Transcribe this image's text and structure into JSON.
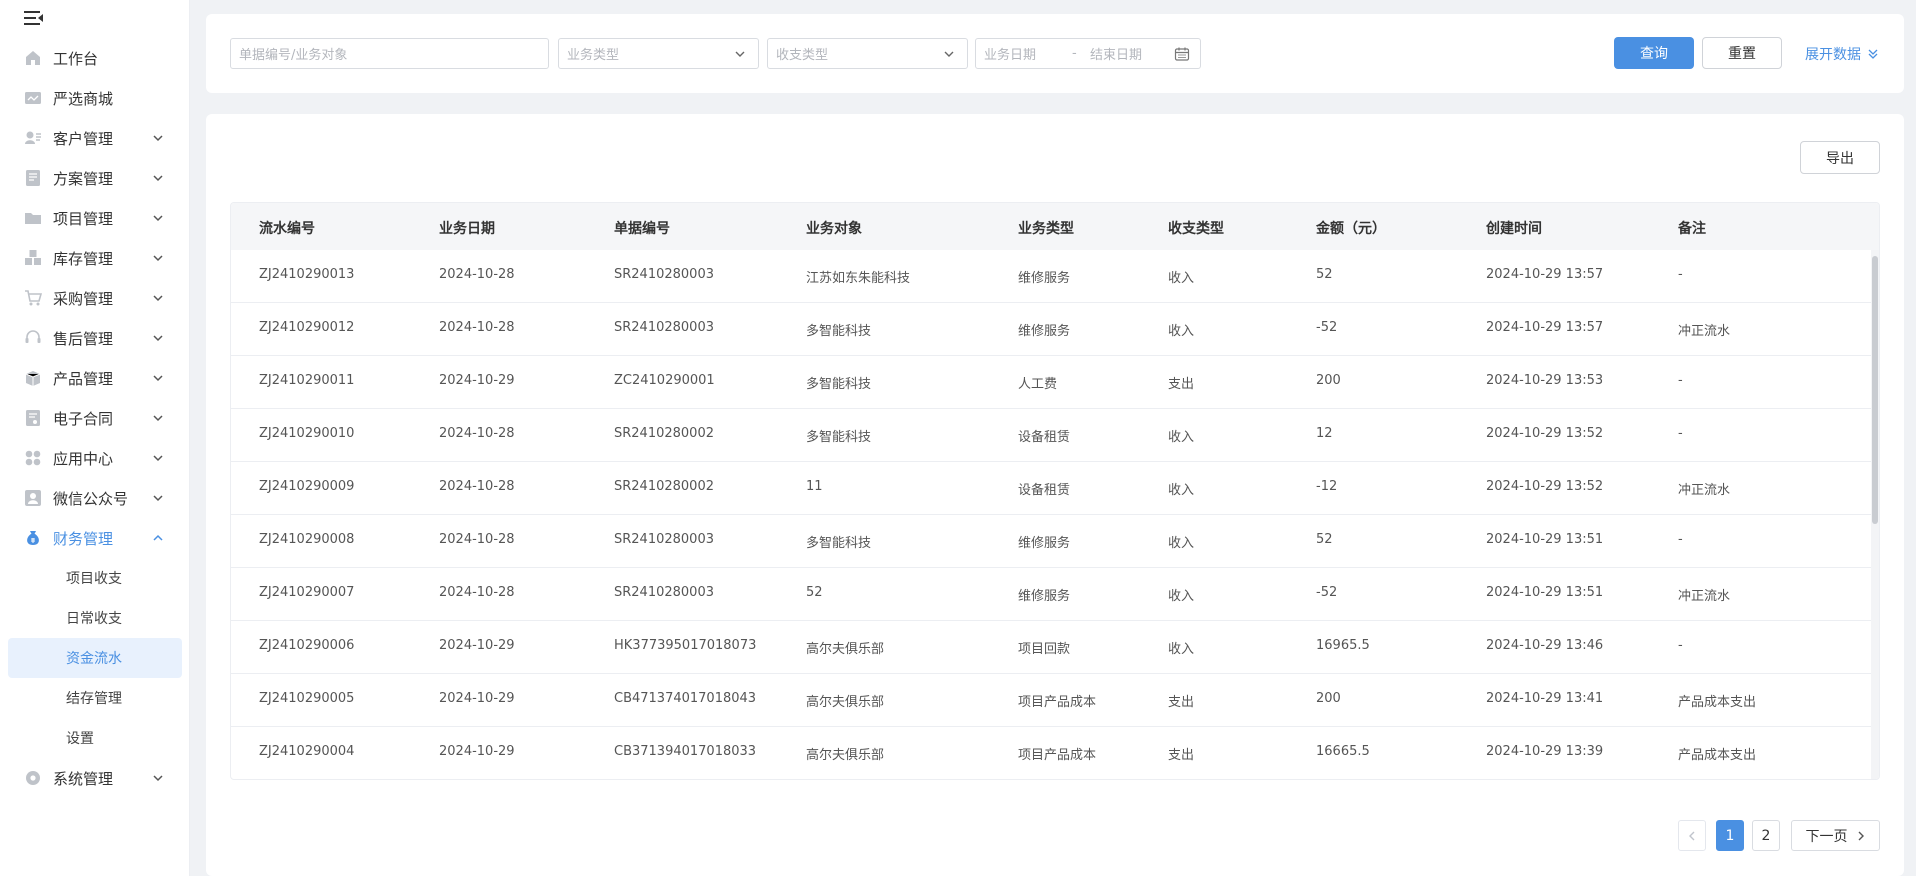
{
  "sidebar": {
    "items": [
      {
        "label": "工作台",
        "icon": "home-icon",
        "has_children": false
      },
      {
        "label": "严选商城",
        "icon": "store-icon",
        "has_children": false
      },
      {
        "label": "客户管理",
        "icon": "customer-icon",
        "has_children": true
      },
      {
        "label": "方案管理",
        "icon": "plan-icon",
        "has_children": true
      },
      {
        "label": "项目管理",
        "icon": "folder-icon",
        "has_children": true
      },
      {
        "label": "库存管理",
        "icon": "inventory-icon",
        "has_children": true
      },
      {
        "label": "采购管理",
        "icon": "cart-icon",
        "has_children": true
      },
      {
        "label": "售后管理",
        "icon": "headset-icon",
        "has_children": true
      },
      {
        "label": "产品管理",
        "icon": "box-icon",
        "has_children": true
      },
      {
        "label": "电子合同",
        "icon": "contract-icon",
        "has_children": true
      },
      {
        "label": "应用中心",
        "icon": "apps-icon",
        "has_children": true
      },
      {
        "label": "微信公众号",
        "icon": "wechat-icon",
        "has_children": true
      },
      {
        "label": "财务管理",
        "icon": "moneybag-icon",
        "has_children": true,
        "expanded": true,
        "active": true
      }
    ],
    "finance_sub": [
      {
        "label": "项目收支"
      },
      {
        "label": "日常收支"
      },
      {
        "label": "资金流水",
        "selected": true
      },
      {
        "label": "结存管理"
      },
      {
        "label": "设置"
      }
    ],
    "last_item": {
      "label": "系统管理",
      "icon": "system-icon",
      "has_children": true
    }
  },
  "filters": {
    "search_placeholder": "单据编号/业务对象",
    "biz_type_placeholder": "业务类型",
    "io_type_placeholder": "收支类型",
    "date_start_placeholder": "业务日期",
    "date_separator": "-",
    "date_end_placeholder": "结束日期",
    "query_label": "查询",
    "reset_label": "重置",
    "expand_label": "展开数据"
  },
  "toolbar": {
    "export_label": "导出"
  },
  "table": {
    "headers": [
      "流水编号",
      "业务日期",
      "单据编号",
      "业务对象",
      "业务类型",
      "收支类型",
      "金额（元）",
      "创建时间",
      "备注"
    ],
    "rows": [
      [
        "ZJ2410290013",
        "2024-10-28",
        "SR2410280003",
        "江苏如东朱能科技",
        "维修服务",
        "收入",
        "52",
        "2024-10-29 13:57",
        "-"
      ],
      [
        "ZJ2410290012",
        "2024-10-28",
        "SR2410280003",
        "多智能科技",
        "维修服务",
        "收入",
        "-52",
        "2024-10-29 13:57",
        "冲正流水"
      ],
      [
        "ZJ2410290011",
        "2024-10-29",
        "ZC2410290001",
        "多智能科技",
        "人工费",
        "支出",
        "200",
        "2024-10-29 13:53",
        "-"
      ],
      [
        "ZJ2410290010",
        "2024-10-28",
        "SR2410280002",
        "多智能科技",
        "设备租赁",
        "收入",
        "12",
        "2024-10-29 13:52",
        "-"
      ],
      [
        "ZJ2410290009",
        "2024-10-28",
        "SR2410280002",
        "11",
        "设备租赁",
        "收入",
        "-12",
        "2024-10-29 13:52",
        "冲正流水"
      ],
      [
        "ZJ2410290008",
        "2024-10-28",
        "SR2410280003",
        "多智能科技",
        "维修服务",
        "收入",
        "52",
        "2024-10-29 13:51",
        "-"
      ],
      [
        "ZJ2410290007",
        "2024-10-28",
        "SR2410280003",
        "52",
        "维修服务",
        "收入",
        "-52",
        "2024-10-29 13:51",
        "冲正流水"
      ],
      [
        "ZJ2410290006",
        "2024-10-29",
        "HK377395017018073",
        "高尔夫俱乐部",
        "项目回款",
        "收入",
        "16965.5",
        "2024-10-29 13:46",
        "-"
      ],
      [
        "ZJ2410290005",
        "2024-10-29",
        "CB471374017018043",
        "高尔夫俱乐部",
        "项目产品成本",
        "支出",
        "200",
        "2024-10-29 13:41",
        "产品成本支出"
      ],
      [
        "ZJ2410290004",
        "2024-10-29",
        "CB371394017018033",
        "高尔夫俱乐部",
        "项目产品成本",
        "支出",
        "16665.5",
        "2024-10-29 13:39",
        "产品成本支出"
      ]
    ]
  },
  "pagination": {
    "pages": [
      "1",
      "2"
    ],
    "current": "1",
    "next_label": "下一页"
  },
  "colors": {
    "accent": "#4a90e2",
    "background": "#f0f2f5",
    "selected_bg": "#e8f1fd"
  }
}
